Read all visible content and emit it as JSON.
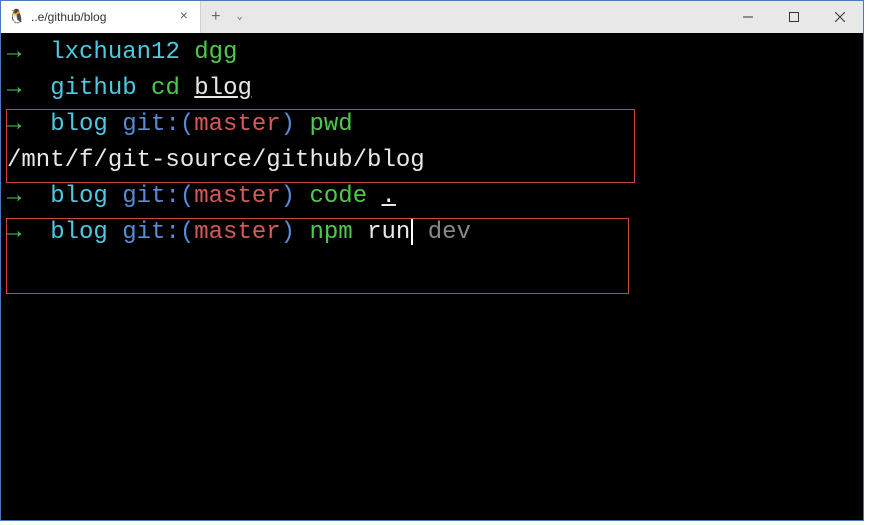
{
  "titlebar": {
    "tab_title": "..e/github/blog",
    "tab_close": "×",
    "tab_add": "+",
    "tab_dropdown": "⌄"
  },
  "lines": {
    "l1": {
      "arrow": "→",
      "dir": "lxchuan12",
      "cmd": "dgg"
    },
    "l2": {
      "arrow": "→",
      "dir": "github",
      "cmd": "cd",
      "arg": "blog"
    },
    "l3": {
      "arrow": "→",
      "dir": "blog",
      "git": "git:(",
      "branch": "master",
      "gitend": ")",
      "cmd": "pwd"
    },
    "l4": {
      "output": "/mnt/f/git-source/github/blog"
    },
    "l5": {
      "arrow": "→",
      "dir": "blog",
      "git": "git:(",
      "branch": "master",
      "gitend": ")",
      "cmd": "code",
      "arg": "."
    },
    "l6": {
      "arrow": "→",
      "dir": "blog",
      "git": "git:(",
      "branch": "master",
      "gitend": ")",
      "cmd": "npm",
      "cmd2": "run",
      "suggestion": " dev"
    }
  }
}
